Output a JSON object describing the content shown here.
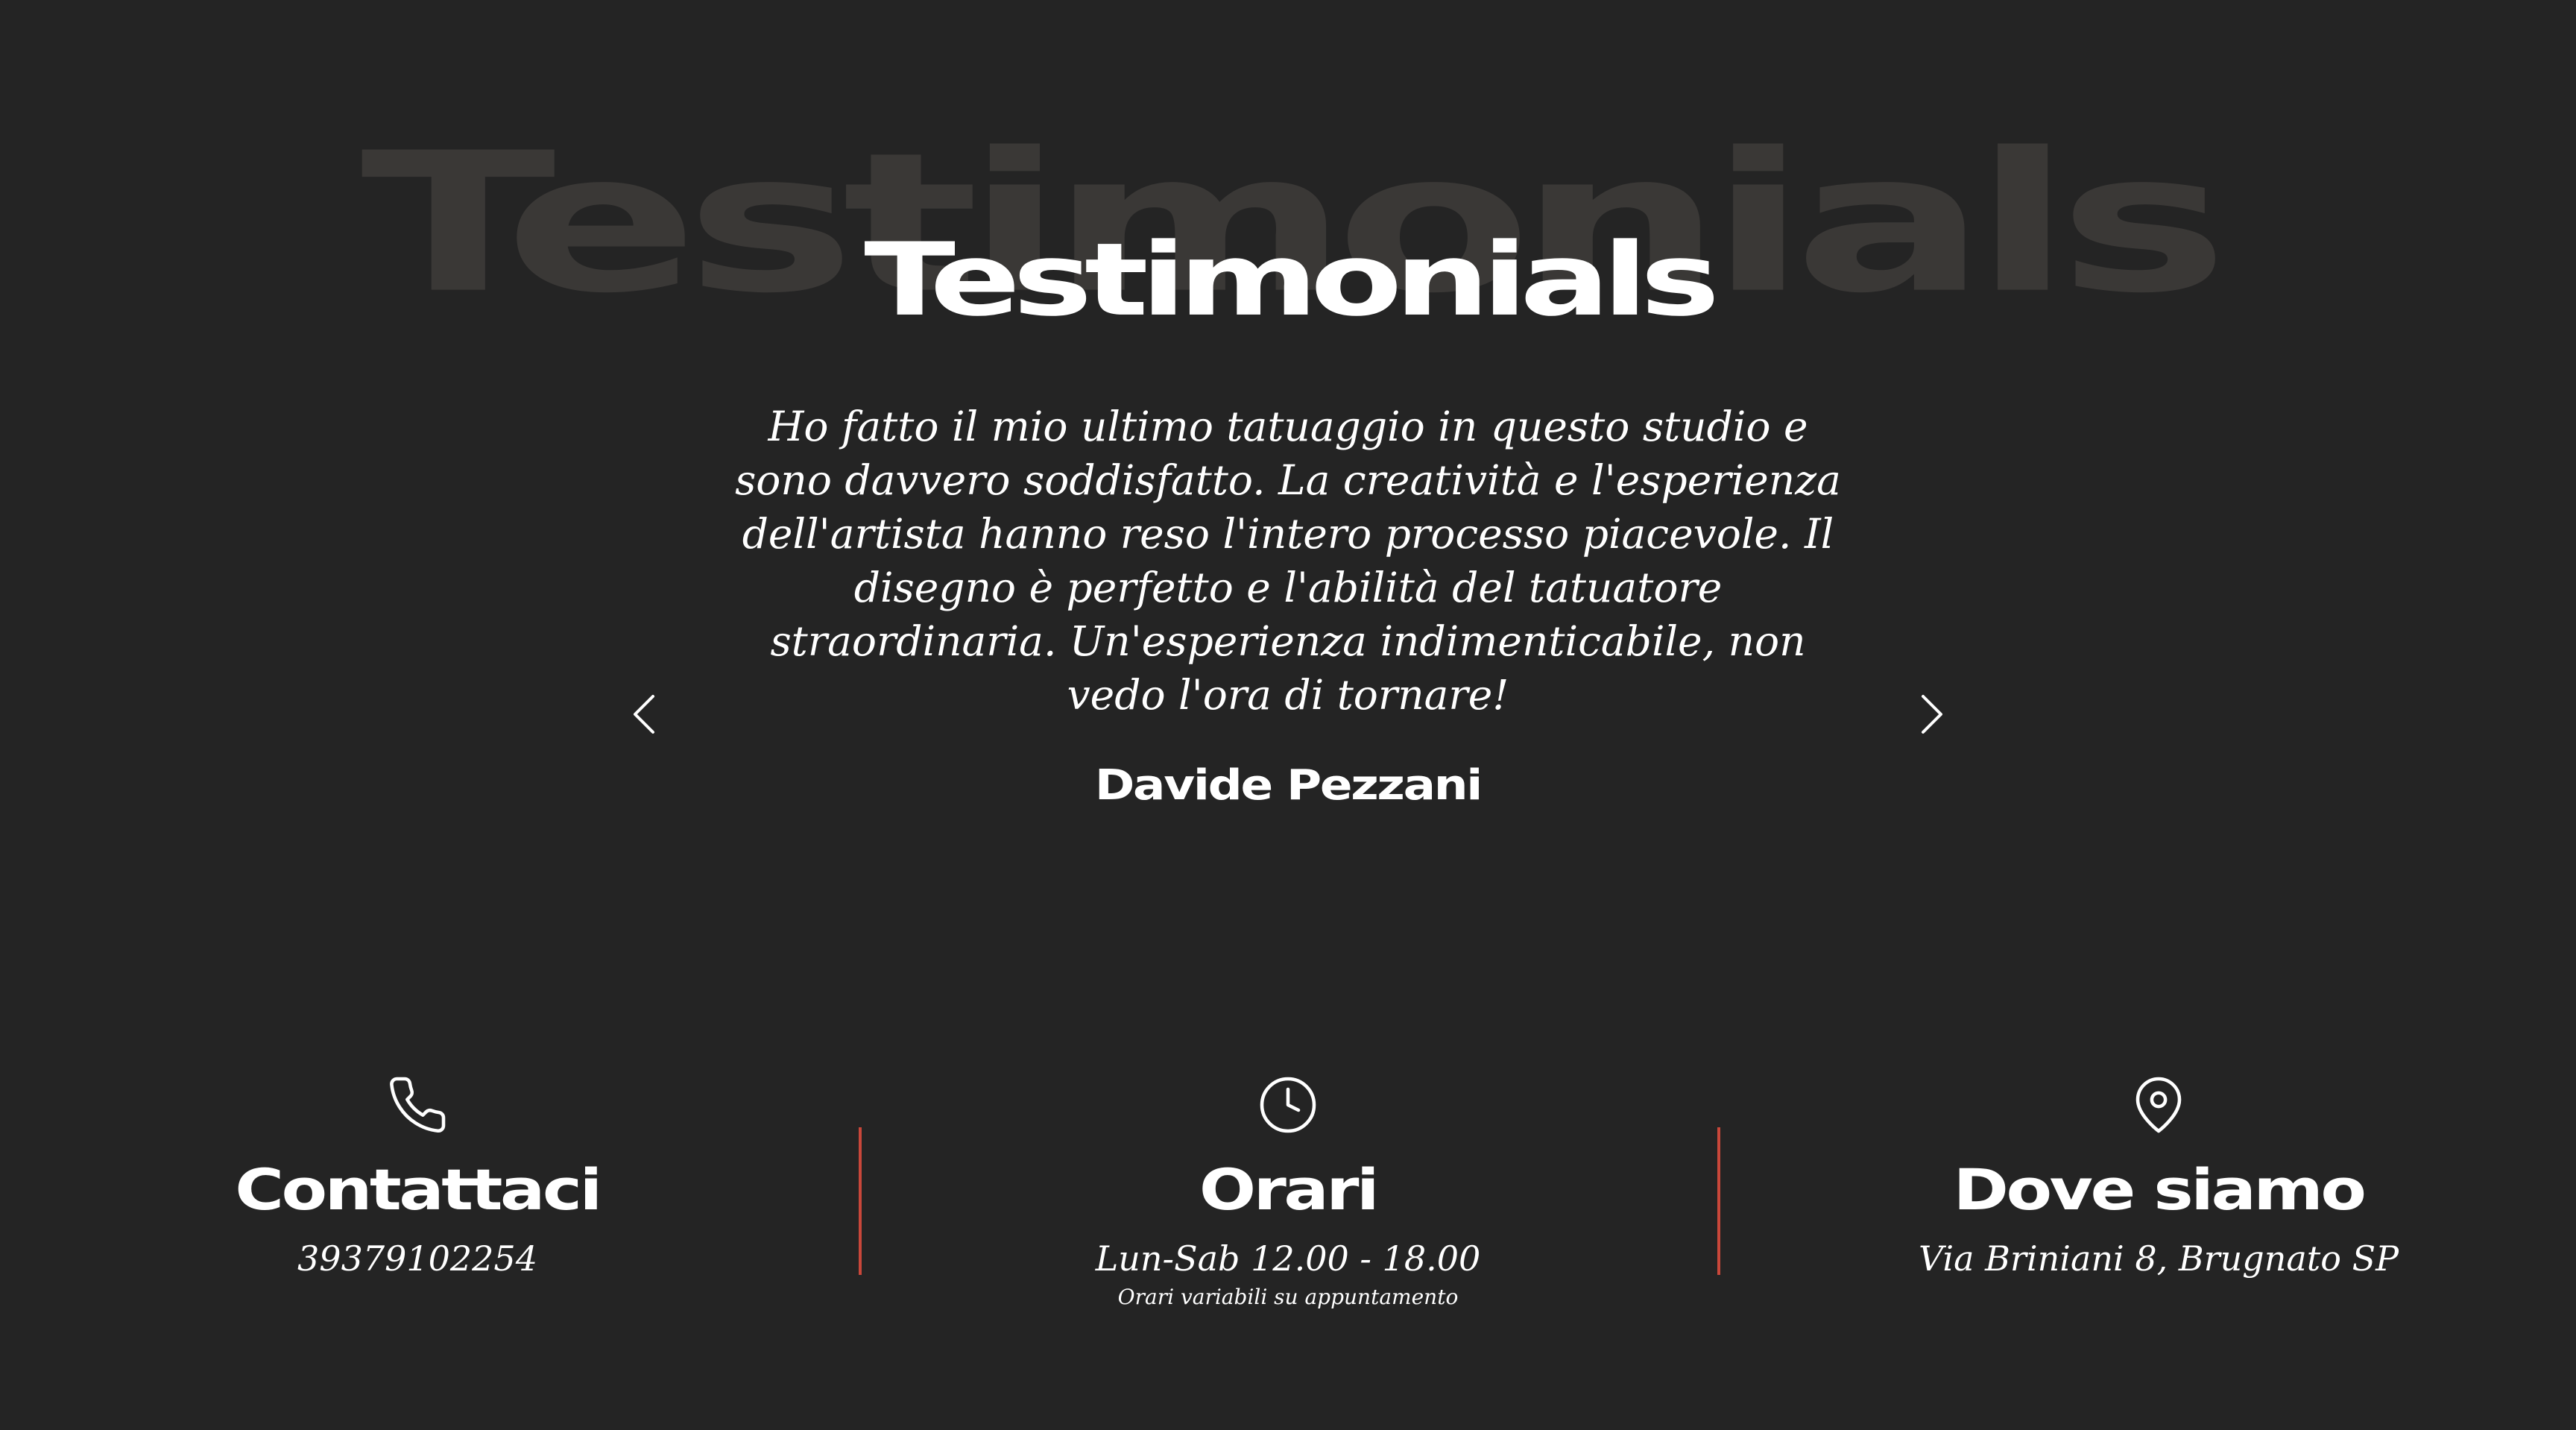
{
  "testimonials": {
    "background_title": "Testimonials",
    "title": "Testimonials",
    "quote": "Ho fatto il mio ultimo tatuaggio in questo studio e sono davvero soddisfatto. La creatività e l'esperienza dell'artista hanno reso l'intero processo piacevole. Il disegno è perfetto e l'abilità del tatuatore straordinaria. Un'esperienza indimenticabile, non vedo l'ora di tornare!",
    "author": "Davide Pezzani",
    "prev_icon": "chevron-left-icon",
    "next_icon": "chevron-right-icon"
  },
  "info": {
    "contact": {
      "icon": "phone-icon",
      "title": "Contattaci",
      "phone": "39379102254"
    },
    "hours": {
      "icon": "clock-icon",
      "title": "Orari",
      "text": "Lun-Sab 12.00 - 18.00",
      "note": "Orari variabili su appuntamento"
    },
    "location": {
      "icon": "map-pin-icon",
      "title": "Dove siamo",
      "address": "Via Briniani 8, Brugnato SP"
    }
  },
  "colors": {
    "background": "#242424",
    "background_title": "#3a3836",
    "text": "#ffffff",
    "divider": "#c9473a"
  }
}
